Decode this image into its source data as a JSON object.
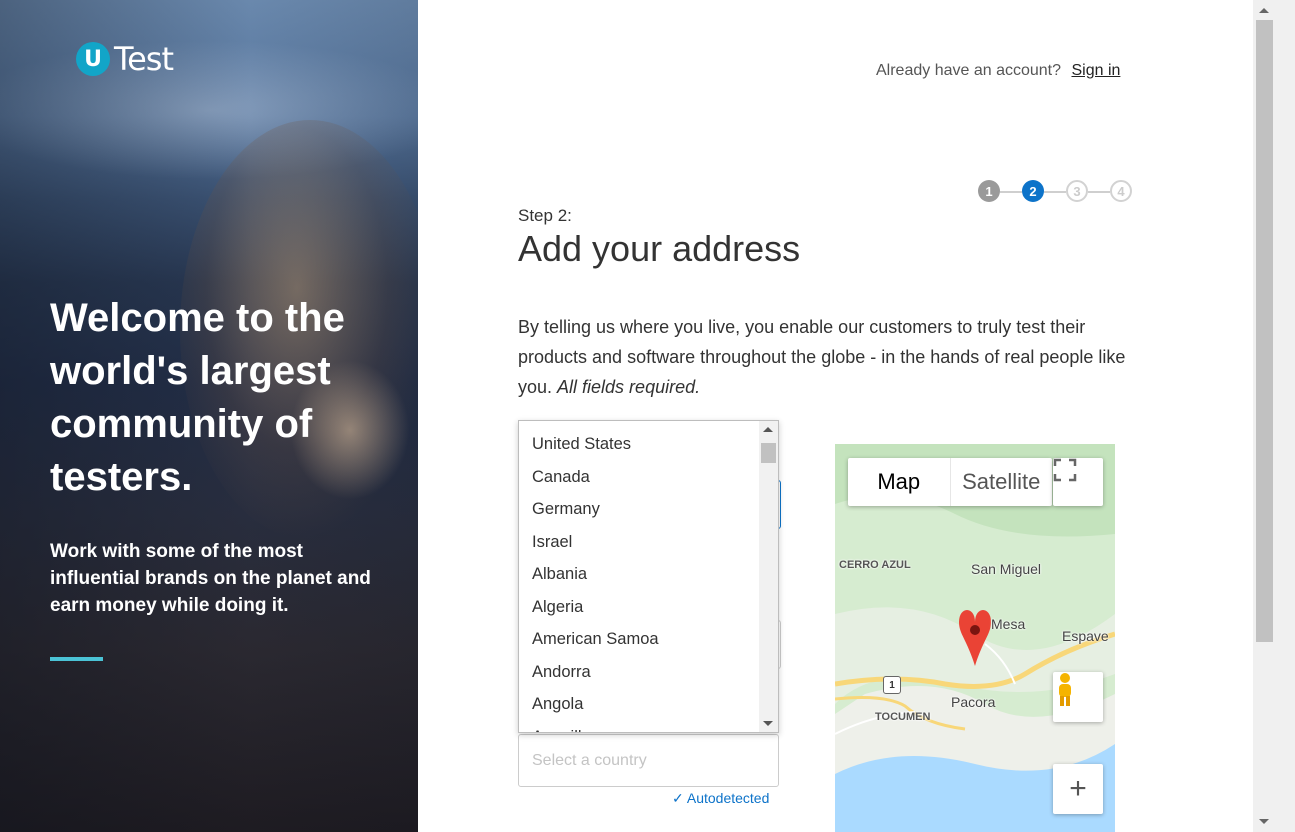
{
  "brand": {
    "logo_letter": "U",
    "logo_text": "Test"
  },
  "hero": {
    "title": "Welcome to the world's largest community of testers.",
    "subtitle": "Work with some of the most influential brands on the planet and earn money while doing it."
  },
  "header": {
    "already_text": "Already have an account?",
    "signin_label": "Sign in"
  },
  "stepper": {
    "steps": [
      "1",
      "2",
      "3",
      "4"
    ],
    "current": 2
  },
  "step_label": "Step 2:",
  "title": "Add your address",
  "intro": {
    "text": "By telling us where you live, you enable our customers to truly test their products and software throughout the globe - in the hands of real people like you. ",
    "emphasis": "All fields required."
  },
  "country_dropdown": {
    "options": [
      "United States",
      "Canada",
      "Germany",
      "Israel",
      "Albania",
      "Algeria",
      "American Samoa",
      "Andorra",
      "Angola",
      "Anguilla"
    ]
  },
  "country_field": {
    "placeholder": "Select a country",
    "autodetected_label": "Autodetected",
    "check_glyph": "✓"
  },
  "map": {
    "tabs": {
      "map": "Map",
      "satellite": "Satellite"
    },
    "labels": {
      "cerro_azul": "CERRO AZUL",
      "san_miguel": "San Miguel",
      "mesa": "Mesa",
      "espave": "Espave",
      "pacora": "Pacora",
      "tocumen": "TOCUMEN"
    },
    "road_number": "1",
    "zoom_in": "+",
    "colors": {
      "land": "#d6ecd0",
      "water": "#aadaff",
      "road": "#f8d779",
      "pin": "#ea4335"
    }
  },
  "colors": {
    "accent": "#0d73c9",
    "hero_rule": "#4bc3d6",
    "logo": "#12a5c8"
  }
}
